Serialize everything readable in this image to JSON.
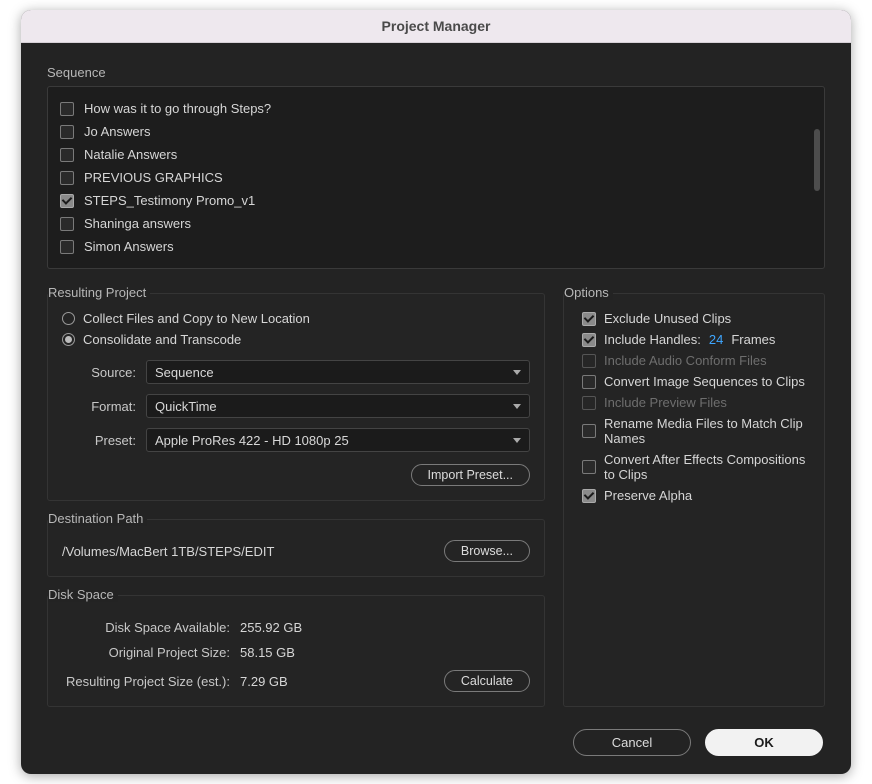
{
  "window": {
    "title": "Project Manager"
  },
  "sequence": {
    "label": "Sequence",
    "items": [
      {
        "label": "How was it to go through Steps?",
        "checked": false
      },
      {
        "label": "Jo Answers",
        "checked": false
      },
      {
        "label": "Natalie Answers",
        "checked": false
      },
      {
        "label": "PREVIOUS GRAPHICS",
        "checked": false
      },
      {
        "label": "STEPS_Testimony Promo_v1",
        "checked": true
      },
      {
        "label": "Shaninga answers",
        "checked": false
      },
      {
        "label": "Simon Answers",
        "checked": false
      }
    ]
  },
  "resulting": {
    "title": "Resulting Project",
    "radio_collect": "Collect Files and Copy to New Location",
    "radio_consolidate": "Consolidate and Transcode",
    "selected": "consolidate",
    "source_label": "Source:",
    "source_value": "Sequence",
    "format_label": "Format:",
    "format_value": "QuickTime",
    "preset_label": "Preset:",
    "preset_value": "Apple ProRes 422 - HD 1080p 25",
    "import_preset": "Import Preset..."
  },
  "destination": {
    "title": "Destination Path",
    "path": "/Volumes/MacBert 1TB/STEPS/EDIT",
    "browse": "Browse..."
  },
  "disk": {
    "title": "Disk Space",
    "avail_label": "Disk Space Available:",
    "avail_value": "255.92 GB",
    "orig_label": "Original Project Size:",
    "orig_value": "58.15 GB",
    "result_label": "Resulting Project Size (est.):",
    "result_value": "7.29 GB",
    "calculate": "Calculate"
  },
  "options": {
    "title": "Options",
    "exclude_unused": "Exclude Unused Clips",
    "include_handles": "Include Handles:",
    "handles_value": "24",
    "handles_unit": "Frames",
    "include_audio_conform": "Include Audio Conform Files",
    "convert_img_seq": "Convert Image Sequences to Clips",
    "include_preview": "Include Preview Files",
    "rename_media": "Rename Media Files to Match Clip Names",
    "convert_ae": "Convert After Effects Compositions to Clips",
    "preserve_alpha": "Preserve Alpha"
  },
  "footer": {
    "cancel": "Cancel",
    "ok": "OK"
  }
}
